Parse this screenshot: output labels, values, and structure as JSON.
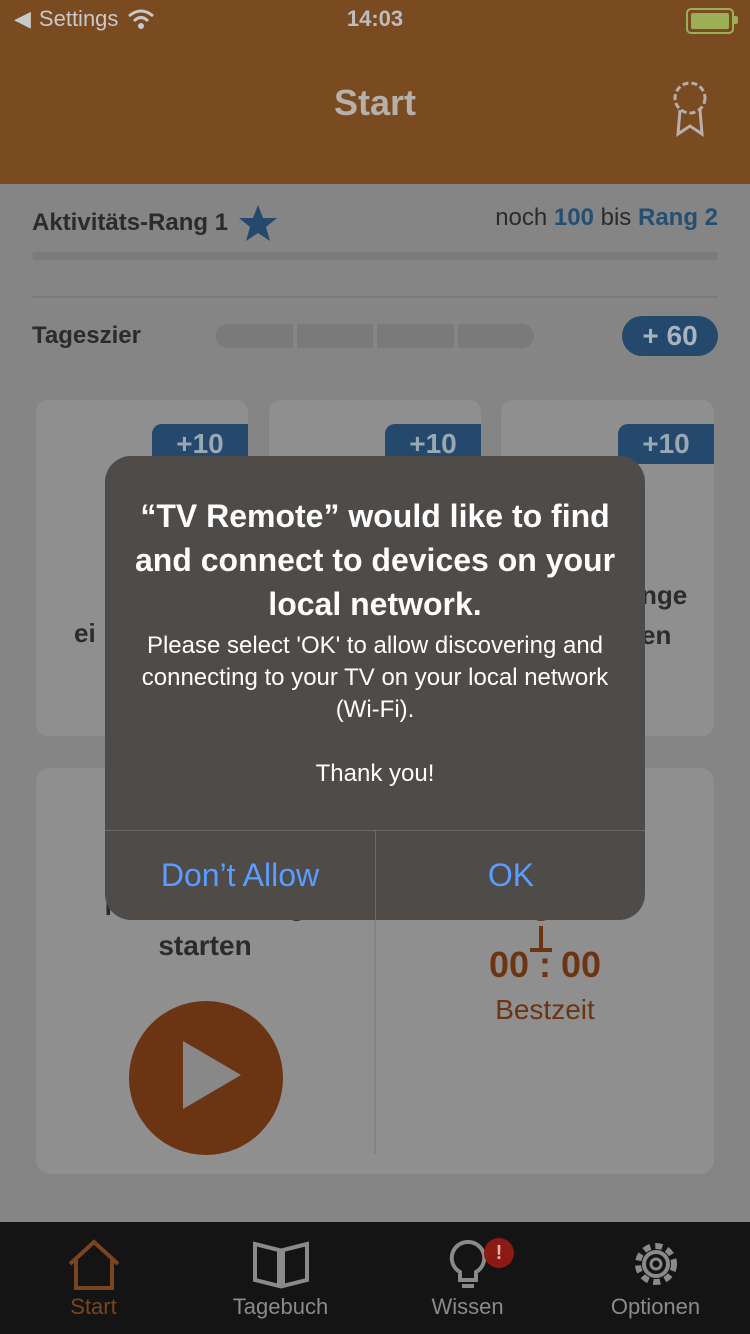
{
  "status_bar": {
    "back_label": "Settings",
    "time": "14:03"
  },
  "nav": {
    "title": "Start"
  },
  "rank": {
    "label": "Aktivitäts-Rang 1",
    "prefix": "noch",
    "points": "100",
    "middle": "bis",
    "next_rank": "Rang 2"
  },
  "daily_goal": {
    "label": "Tageszier",
    "points": "+ 60"
  },
  "cards": [
    {
      "badge": "+10",
      "partial_text": "ei"
    },
    {
      "badge": "+10",
      "partial_text": ""
    },
    {
      "badge": "+10",
      "partial_text_1": "nge",
      "partial_text_2": "en"
    }
  ],
  "training": {
    "label_line1": "Neues Training",
    "label_line2": "starten",
    "time": "00 : 00",
    "best_label": "Bestzeit"
  },
  "tabs": [
    {
      "label": "Start"
    },
    {
      "label": "Tagebuch"
    },
    {
      "label": "Wissen"
    },
    {
      "label": "Optionen"
    }
  ],
  "notification_badge": "!",
  "alert": {
    "title": "“TV Remote” would like to find and connect to devices on your local network.",
    "message": "Please select 'OK' to allow discovering and connecting to your TV on your local network (Wi-Fi).\n\nThank you!",
    "deny_label": "Don’t Allow",
    "ok_label": "OK"
  },
  "colors": {
    "accent": "#7a4a20",
    "alert_button": "#5a9cff",
    "rank_blue": "#24496c"
  }
}
